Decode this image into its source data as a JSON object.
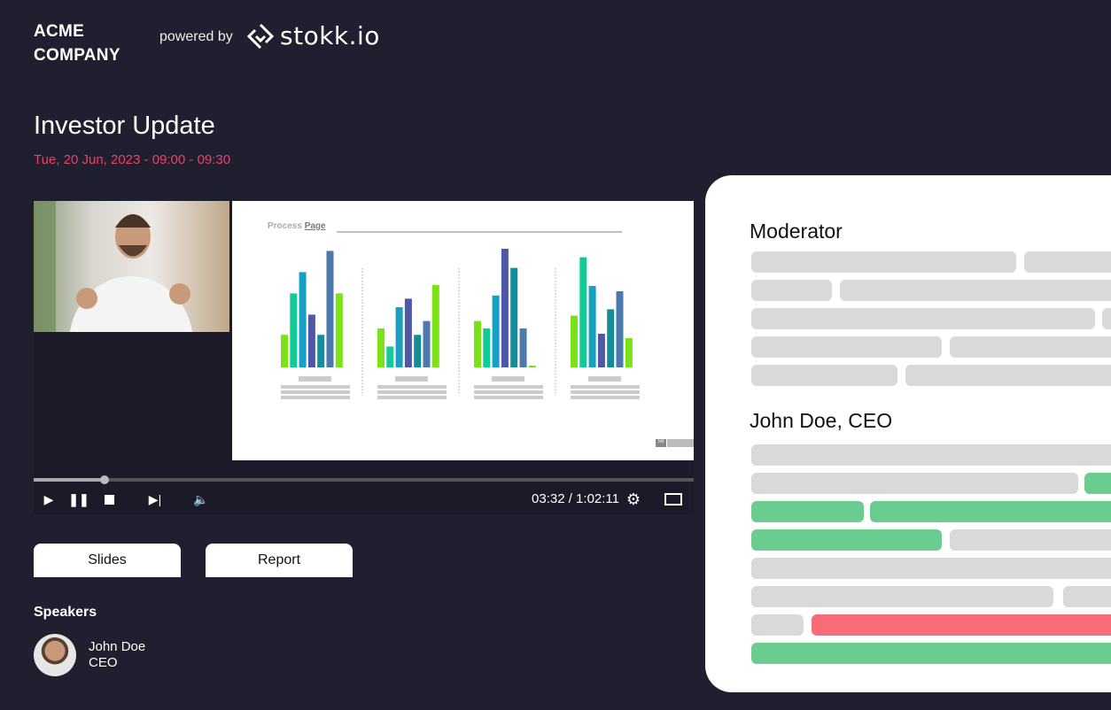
{
  "header": {
    "company_line1": "ACME",
    "company_line2": "COMPANY",
    "powered_by": "powered by",
    "logo_text": "stokk.io"
  },
  "event": {
    "title": "Investor Update",
    "datetime": "Tue, 20 Jun, 2023 - 09:00 - 09:30"
  },
  "player": {
    "slide_title_light": "Process",
    "slide_title_bold": "Page",
    "slide_number": "59",
    "current_time": "03:32",
    "total_time": "1:02:11",
    "time_display": "03:32 / 1:02:11",
    "progress_percent": 0.108
  },
  "buttons": {
    "slides": "Slides",
    "report": "Report"
  },
  "speakers": {
    "heading": "Speakers",
    "items": [
      {
        "name": "John Doe",
        "role": "CEO"
      }
    ]
  },
  "transcript": {
    "sections": [
      {
        "speaker": "Moderator"
      },
      {
        "speaker": "John Doe, CEO"
      }
    ]
  },
  "colors": {
    "background": "#1f1f2f",
    "date": "#e8416b",
    "highlight_green": "#6acd8f",
    "highlight_red": "#f76d77"
  }
}
